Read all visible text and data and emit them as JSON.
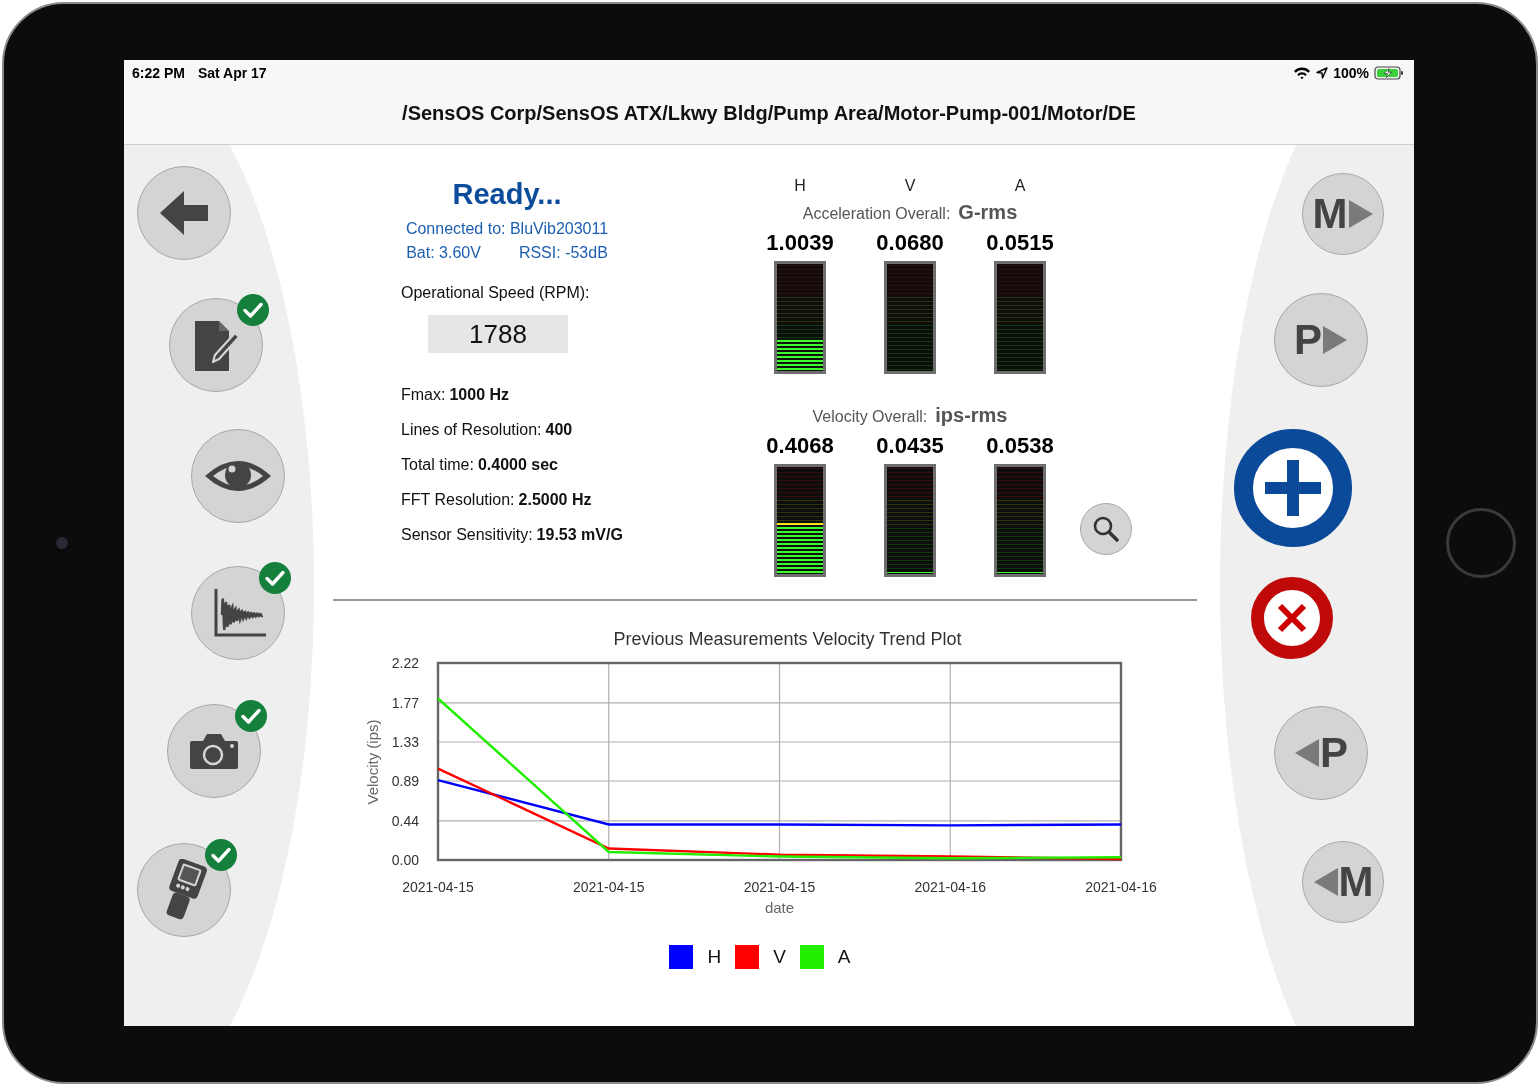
{
  "status_bar": {
    "time": "6:22 PM",
    "date": "Sat Apr 17",
    "battery": "100%"
  },
  "title": "/SensOS Corp/SensOS ATX/Lkwy Bldg/Pump Area/Motor-Pump-001/Motor/DE",
  "left_toolbar": [
    {
      "kind": "back",
      "checked": false
    },
    {
      "kind": "notes",
      "checked": true
    },
    {
      "kind": "view",
      "checked": false
    },
    {
      "kind": "waveform",
      "checked": true
    },
    {
      "kind": "camera",
      "checked": true
    },
    {
      "kind": "sensor",
      "checked": true
    }
  ],
  "status": {
    "state": "Ready...",
    "connection": "Connected to: BluVib203011",
    "battery": "Bat: 3.60V",
    "rssi": "RSSI: -53dB"
  },
  "speed": {
    "label": "Operational Speed (RPM):",
    "value": "1788"
  },
  "parameters": [
    {
      "label": "Fmax:",
      "value": "1000 Hz"
    },
    {
      "label": "Lines of Resolution:",
      "value": "400"
    },
    {
      "label": "Total time:",
      "value": "0.4000 sec"
    },
    {
      "label": "FFT Resolution:",
      "value": "2.5000 Hz"
    },
    {
      "label": "Sensor Sensitivity:",
      "value": "19.53 mV/G"
    }
  ],
  "axes": [
    "H",
    "V",
    "A"
  ],
  "overall_groups": [
    {
      "label": "Acceleration Overall:",
      "unit": "G-rms",
      "meters": [
        {
          "value": "1.0039",
          "level": 0.3
        },
        {
          "value": "0.0680",
          "level": 0
        },
        {
          "value": "0.0515",
          "level": 0
        }
      ]
    },
    {
      "label": "Velocity Overall:",
      "unit": "ips-rms",
      "meters": [
        {
          "value": "0.4068",
          "level": 0.48
        },
        {
          "value": "0.0435",
          "level": 0.02
        },
        {
          "value": "0.0538",
          "level": 0.02
        }
      ]
    }
  ],
  "right_toolbar": [
    {
      "kind": "next",
      "letter": "M"
    },
    {
      "kind": "next",
      "letter": "P"
    },
    {
      "kind": "add"
    },
    {
      "kind": "cancel"
    },
    {
      "kind": "previous",
      "letter": "P"
    },
    {
      "kind": "previous",
      "letter": "M"
    }
  ],
  "trend": {
    "chart_data": {
      "type": "line",
      "title": "Previous Measurements Velocity Trend Plot",
      "xlabel": "date",
      "ylabel": "Velocity (ips)",
      "categories": [
        "2021-04-15",
        "2021-04-15",
        "2021-04-15",
        "2021-04-16",
        "2021-04-16"
      ],
      "ylim": [
        0,
        2.22
      ],
      "grid": true,
      "legend": "bottom",
      "yticks": [
        {
          "value": 0,
          "label": "0.00"
        },
        {
          "value": 0.44,
          "label": "0.44"
        },
        {
          "value": 0.89,
          "label": "0.89"
        },
        {
          "value": 1.33,
          "label": "1.33"
        },
        {
          "value": 1.77,
          "label": "1.77"
        },
        {
          "value": 2.22,
          "label": "2.22"
        }
      ],
      "series": [
        {
          "name": "H",
          "color": "#0000ff",
          "values": [
            0.9,
            0.4,
            0.4,
            0.39,
            0.4
          ]
        },
        {
          "name": "V",
          "color": "#ff0000",
          "values": [
            1.03,
            0.13,
            0.06,
            0.04,
            0.01
          ]
        },
        {
          "name": "A",
          "color": "#22ee00",
          "values": [
            1.82,
            0.09,
            0.04,
            0.02,
            0.03
          ]
        }
      ]
    }
  }
}
